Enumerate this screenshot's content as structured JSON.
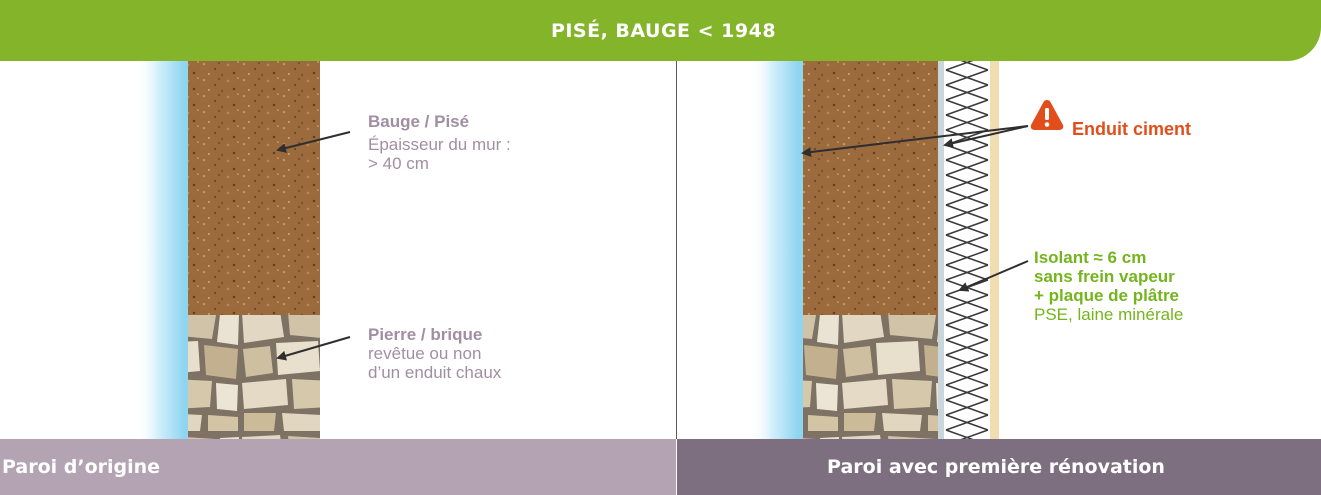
{
  "header": {
    "title": "PISÉ, BAUGE < 1948"
  },
  "left_panel": {
    "footer_label": "Paroi d’origine",
    "annotations": {
      "bauge_title": "Bauge / Pisé",
      "bauge_line1": "Épaisseur du mur :",
      "bauge_line2": "> 40 cm",
      "stone_title": "Pierre / brique",
      "stone_line1": "revêtue ou non",
      "stone_line2": "d’un enduit chaux"
    }
  },
  "right_panel": {
    "footer_label": "Paroi avec première rénovation",
    "annotations": {
      "warning_label": "Enduit ciment",
      "insulation_line1": "Isolant ≈ 6 cm",
      "insulation_line2": "sans frein vapeur",
      "insulation_line3": "+ plaque de plâtre",
      "insulation_line4": "PSE, laine minérale"
    },
    "warning_icon": "warning-triangle-icon"
  },
  "colors": {
    "banner_green": "#84b42a",
    "earth_brown": "#9b6a3d",
    "stone_beige": "#d9cdb8",
    "plaster_blue": "#9fdcf2",
    "plasterboard_cream": "#f0ddb0",
    "annotation_mauve": "#a28ea3",
    "annotation_green": "#74b51e",
    "warning_orange": "#e24e1b",
    "footer_left": "#b3a3b3",
    "footer_right": "#7e6f80"
  }
}
